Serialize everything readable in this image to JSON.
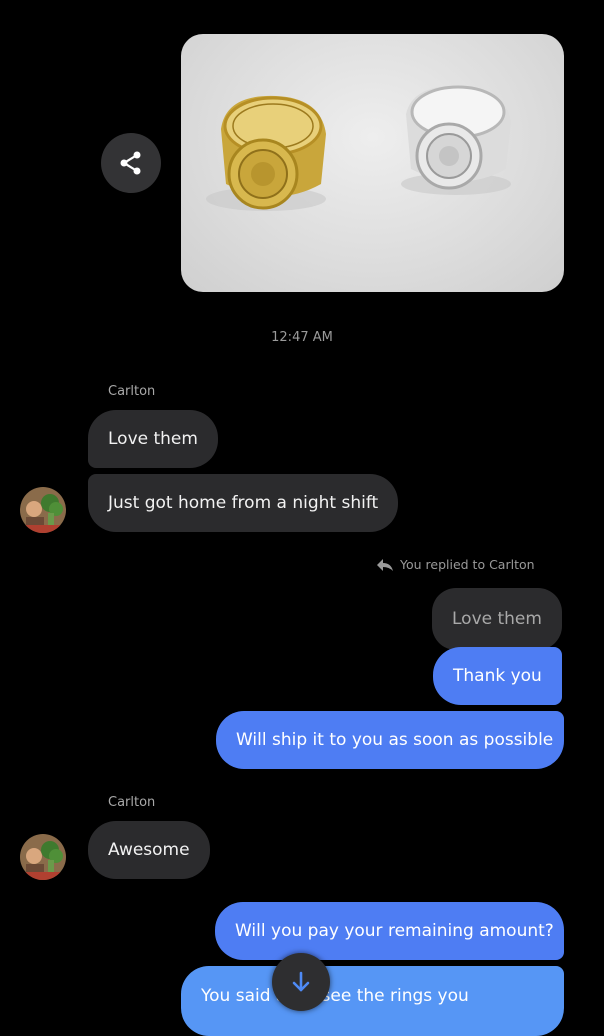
{
  "timestamp": "12:47 AM",
  "messages": {
    "group1_sender": "Carlton",
    "in1": "Love them",
    "in2": "Just got home from a night shift",
    "replied_label": "You replied to Carlton",
    "quoted": "Love them",
    "out1": "Thank you",
    "out2": "Will ship it to you as soon as possible",
    "group2_sender": "Carlton",
    "in3": "Awesome",
    "out3": "Will you pay your remaining amount?",
    "out4": "You said after see the rings you"
  },
  "colors": {
    "outgoing_bubble": "#4e7df3",
    "incoming_bubble": "#2b2b2d",
    "background": "#000000"
  },
  "icons": {
    "share": "share-icon",
    "reply": "reply-arrow-icon",
    "scroll_down": "arrow-down-icon"
  }
}
